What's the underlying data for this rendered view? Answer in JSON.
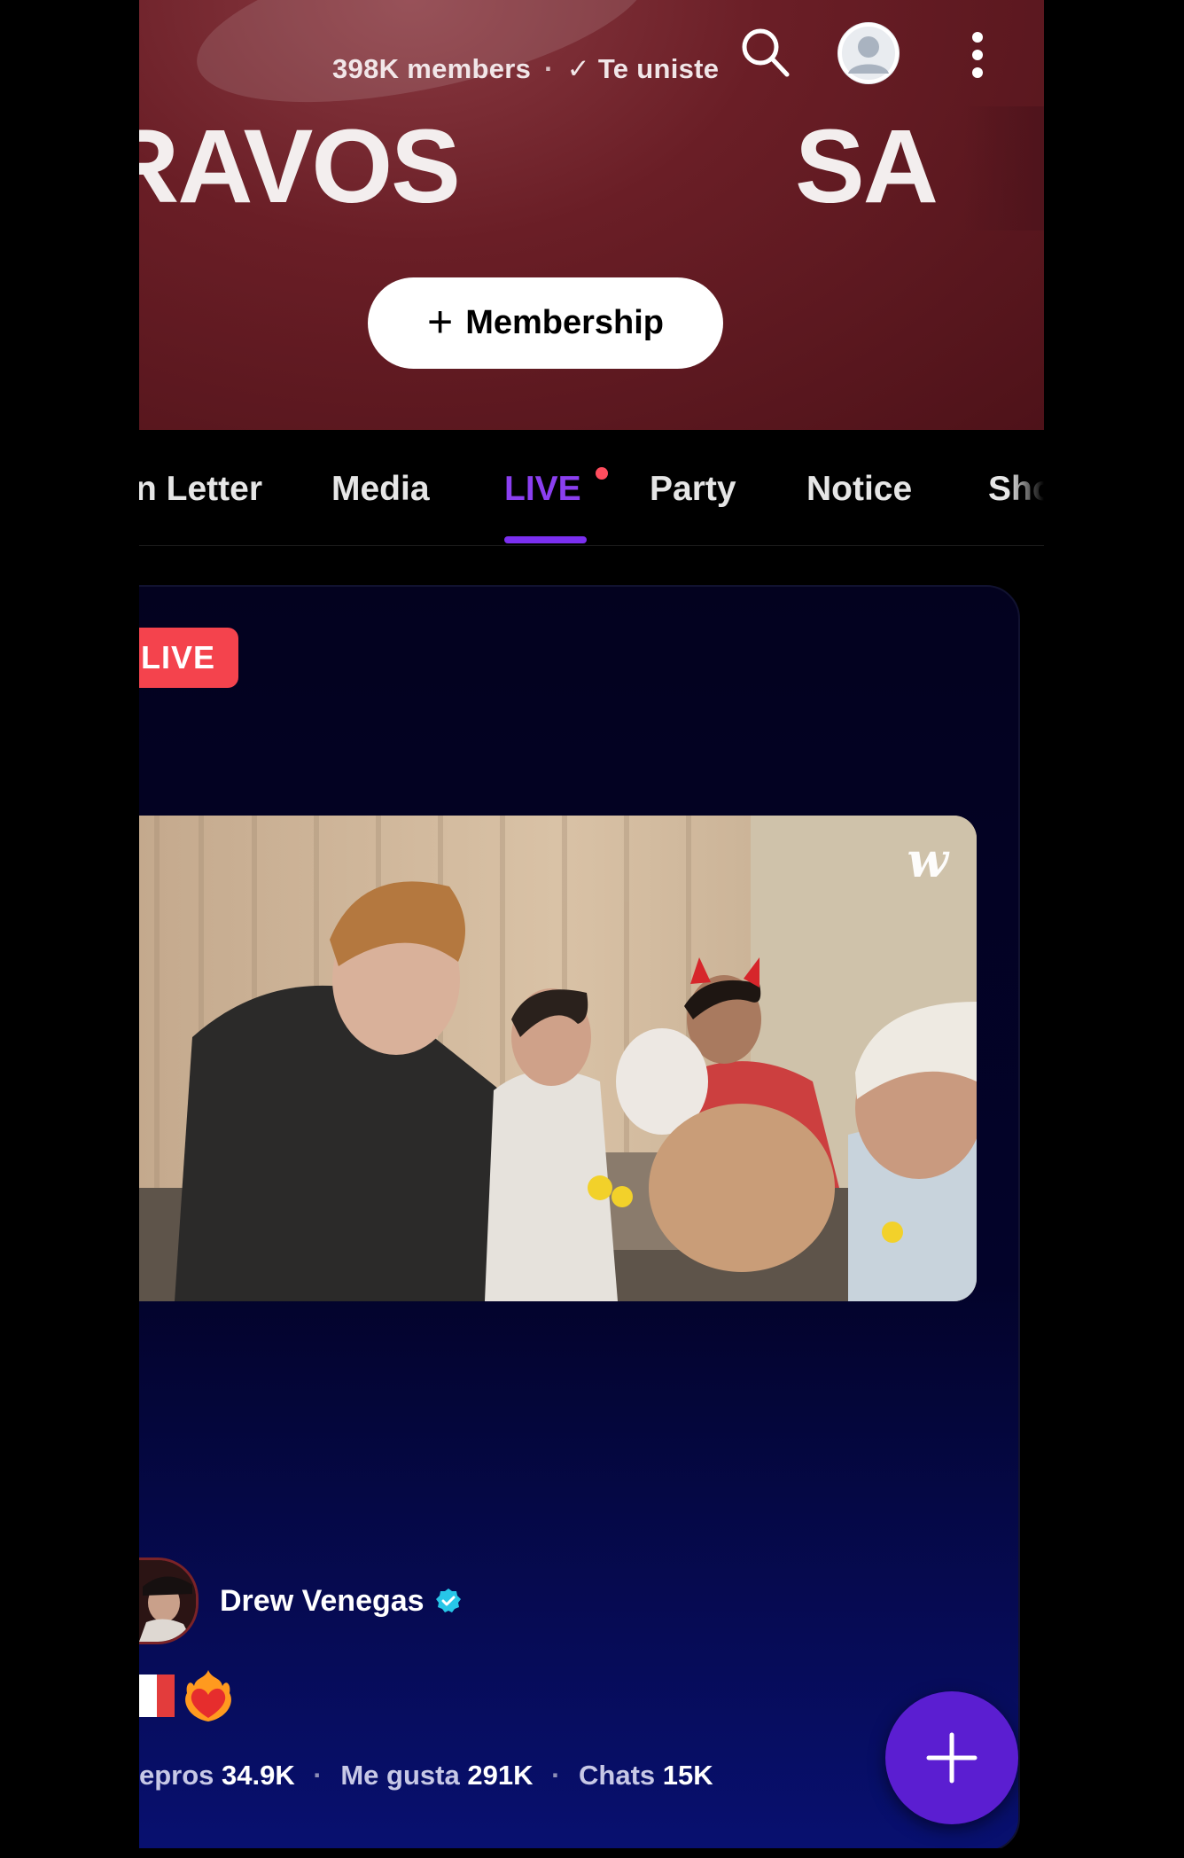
{
  "header": {
    "members_count": "398K members",
    "separator": "·",
    "joined_check": "✓",
    "joined_label": "Te uniste",
    "banner_left": "RAVOS",
    "banner_right": "SA",
    "membership_plus": "+",
    "membership_label": "Membership",
    "colors": {
      "background": "#6a1e26"
    }
  },
  "tabs": {
    "items": [
      {
        "label": "n Letter"
      },
      {
        "label": "Media"
      },
      {
        "label": "LIVE"
      },
      {
        "label": "Party"
      },
      {
        "label": "Notice"
      },
      {
        "label": "Sho"
      }
    ],
    "active": "LIVE",
    "accent_color": "#7b2ff0"
  },
  "live_card": {
    "badge": "LIVE",
    "watermark": "w",
    "author": {
      "name": "Drew Venegas",
      "verified": true
    },
    "emoji_flag": "france-flag",
    "emoji_heart": "heart-on-fire",
    "stats": {
      "plays_label": "epros",
      "plays_value": "34.9K",
      "likes_label": "Me gusta",
      "likes_value": "291K",
      "chats_label": "Chats",
      "chats_value": "15K",
      "separator": "·"
    }
  },
  "fab": {
    "icon": "plus-icon",
    "color": "#5b1ed1"
  }
}
